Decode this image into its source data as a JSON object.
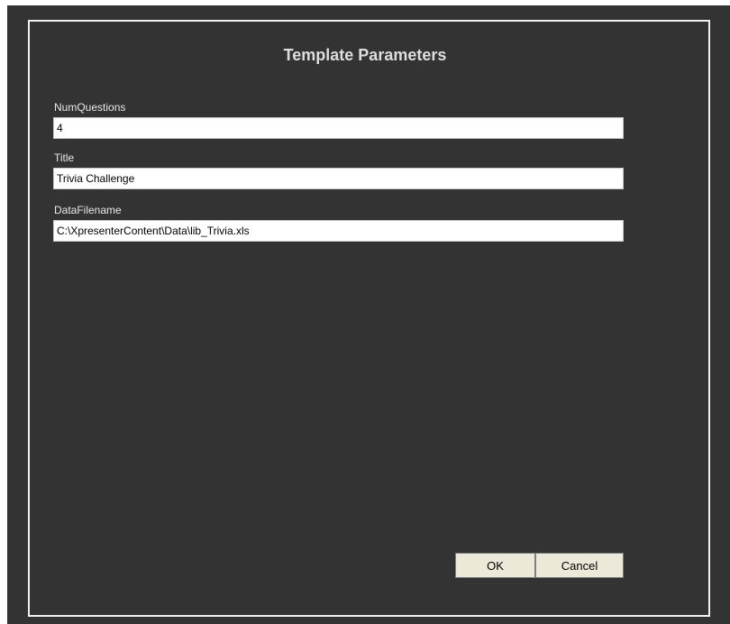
{
  "dialog": {
    "title": "Template Parameters",
    "fields": [
      {
        "label": "NumQuestions",
        "value": "4"
      },
      {
        "label": "Title",
        "value": "Trivia Challenge"
      },
      {
        "label": "DataFilename",
        "value": "C:\\XpresenterContent\\Data\\lib_Trivia.xls"
      }
    ],
    "buttons": {
      "ok_label": "OK",
      "cancel_label": "Cancel"
    }
  },
  "colors": {
    "background": "#333333",
    "border": "#f2f2f2",
    "title_text": "#dedede",
    "button_face": "#ece9d8"
  }
}
